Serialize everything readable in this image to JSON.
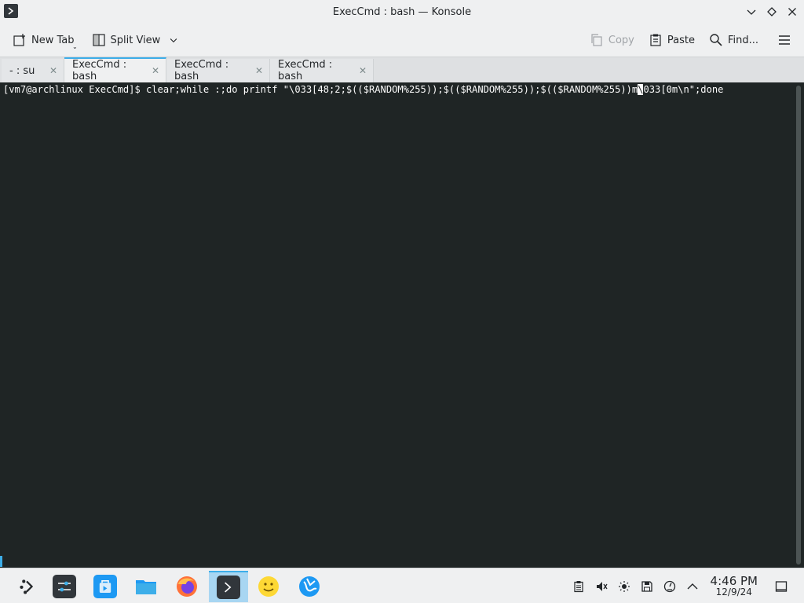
{
  "window": {
    "title": "ExecCmd : bash — Konsole"
  },
  "toolbar": {
    "new_tab_label": "New Tab",
    "split_view_label": "Split View",
    "copy_label": "Copy",
    "paste_label": "Paste",
    "find_label": "Find..."
  },
  "tabs": [
    {
      "label": "- : su"
    },
    {
      "label": "ExecCmd : bash"
    },
    {
      "label": "ExecCmd : bash"
    },
    {
      "label": "ExecCmd : bash"
    }
  ],
  "terminal": {
    "line_before_cursor": "[vm7@archlinux ExecCmd]$ clear;while :;do printf \"\\033[48;2;$(($RANDOM%255));$(($RANDOM%255));$(($RANDOM%255))m",
    "cursor_char": "\\",
    "line_after_cursor": "033[0m\\n\";done"
  },
  "taskbar": {
    "items": [
      {
        "name": "application-launcher",
        "icon": "launcher-icon"
      },
      {
        "name": "system-settings",
        "icon": "settings-icon"
      },
      {
        "name": "discover",
        "icon": "store-icon"
      },
      {
        "name": "dolphin",
        "icon": "folder-icon"
      },
      {
        "name": "firefox",
        "icon": "firefox-icon"
      },
      {
        "name": "konsole",
        "icon": "terminal-icon",
        "active": true
      },
      {
        "name": "emoji",
        "icon": "smiley-icon"
      },
      {
        "name": "browser",
        "icon": "globe-icon"
      }
    ],
    "clock_time": "4:46 PM",
    "clock_date": "12/9/24"
  },
  "colors": {
    "accent": "#3daee9",
    "terminal_bg": "#1f2525",
    "terminal_fg": "#fcfcfc",
    "chrome_bg": "#eff0f1"
  }
}
